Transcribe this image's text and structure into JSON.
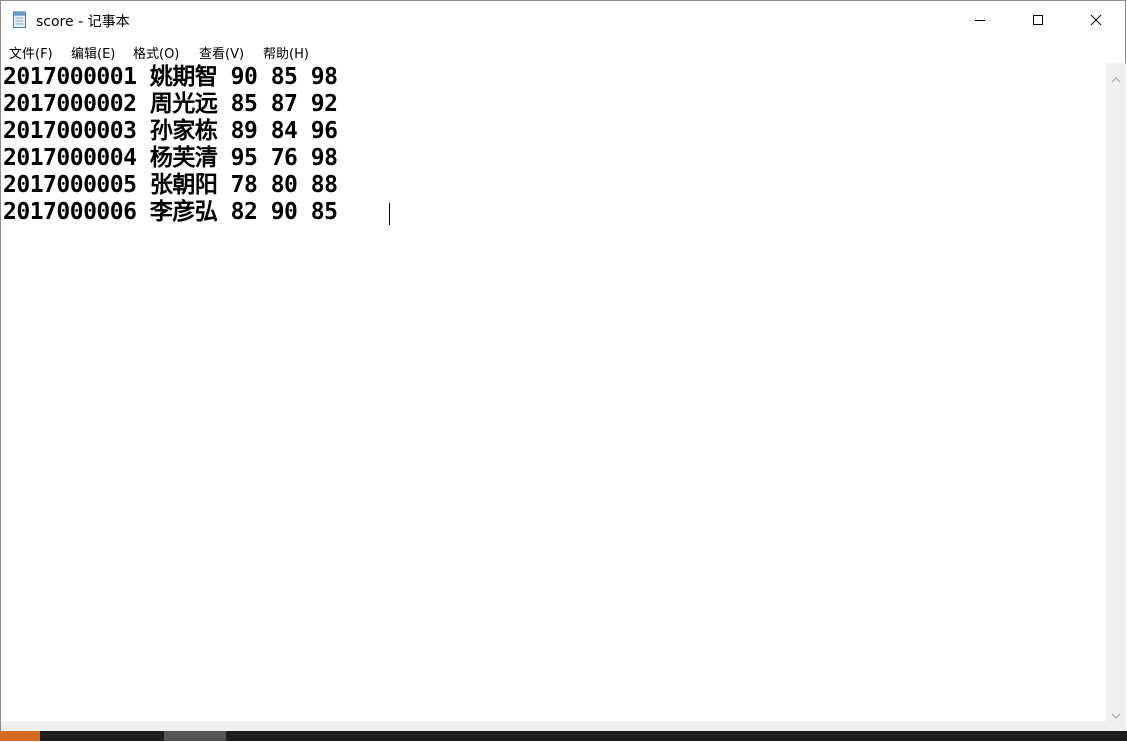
{
  "window": {
    "title": "score - 记事本"
  },
  "icons": {
    "app": "notepad-icon",
    "minimize": "minimize-icon",
    "maximize": "maximize-icon",
    "close": "close-icon"
  },
  "menu": [
    {
      "label": "文件(F)"
    },
    {
      "label": "编辑(E)"
    },
    {
      "label": "格式(O)"
    },
    {
      "label": "查看(V)"
    },
    {
      "label": "帮助(H)"
    }
  ],
  "editor": {
    "lines": [
      "2017000001 姚期智 90 85 98",
      "2017000002 周光远 85 87 92",
      "2017000003 孙家栋 89 84 96",
      "2017000004 杨芙清 95 76 98",
      "2017000005 张朝阳 78 80 88",
      "2017000006 李彦弘 82 90 85"
    ]
  }
}
